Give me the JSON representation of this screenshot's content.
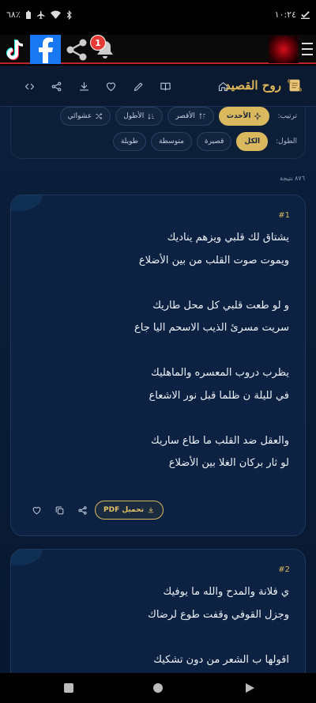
{
  "status_bar": {
    "time": "١٠:٢٤",
    "battery": "٦٨٪"
  },
  "app_bar": {
    "notification_count": "1",
    "icons": [
      "tiktok-icon",
      "facebook-icon",
      "share-icon",
      "bell-icon",
      "menu-icon"
    ]
  },
  "header": {
    "title": "روح القصيد",
    "icons": [
      "home-icon",
      "book-icon",
      "edit-icon",
      "heart-icon",
      "download-icon",
      "share-icon",
      "code-icon"
    ]
  },
  "filters": {
    "sort_label": "ترتيب:",
    "sort_options": [
      {
        "label": "الأحدث",
        "active": true,
        "icon": "sparkle-icon"
      },
      {
        "label": "الأقصر",
        "active": false,
        "icon": "sort-icon"
      },
      {
        "label": "الأطول",
        "active": false,
        "icon": "sort-icon"
      },
      {
        "label": "عشوائي",
        "active": false,
        "icon": "shuffle-icon"
      }
    ],
    "length_label": "الطول:",
    "length_options": [
      {
        "label": "الكل",
        "active": true
      },
      {
        "label": "قصيرة",
        "active": false
      },
      {
        "label": "متوسطة",
        "active": false
      },
      {
        "label": "طويلة",
        "active": false
      }
    ]
  },
  "results_count": "٨٧٦ نتيجة",
  "cards": [
    {
      "number": "#1",
      "lines": [
        "يشتاق لك قلبي ويزهم يناديك",
        "ويموت صوت القلب من بين الأضلاع",
        "",
        "و لو طعت قلبي كل محل طاريك",
        "سريت مسرئ الذيب الاسحم اليا جاع",
        "",
        "يظرب دروب المعسره والماهليك",
        "في لليلة ن ظلما قبل نور الاشعاع",
        "",
        "والعقل ضد القلب ما طاع ساريك",
        "لو ثار بركان الغلا بين الأضلاع"
      ],
      "pdf_label": "تحميل PDF"
    },
    {
      "number": "#2",
      "lines": [
        "ي فلانة والمدح والله ما يوفيك",
        "وجزل القوفي وقفت طوع لرضاك",
        "",
        "اقولها ب الشعر من دون تشكيك"
      ]
    }
  ],
  "colors": {
    "accent": "#d9b85e",
    "background": "#0c1f3c",
    "appbar_line": "#c0242a",
    "facebook": "#1877f2"
  }
}
